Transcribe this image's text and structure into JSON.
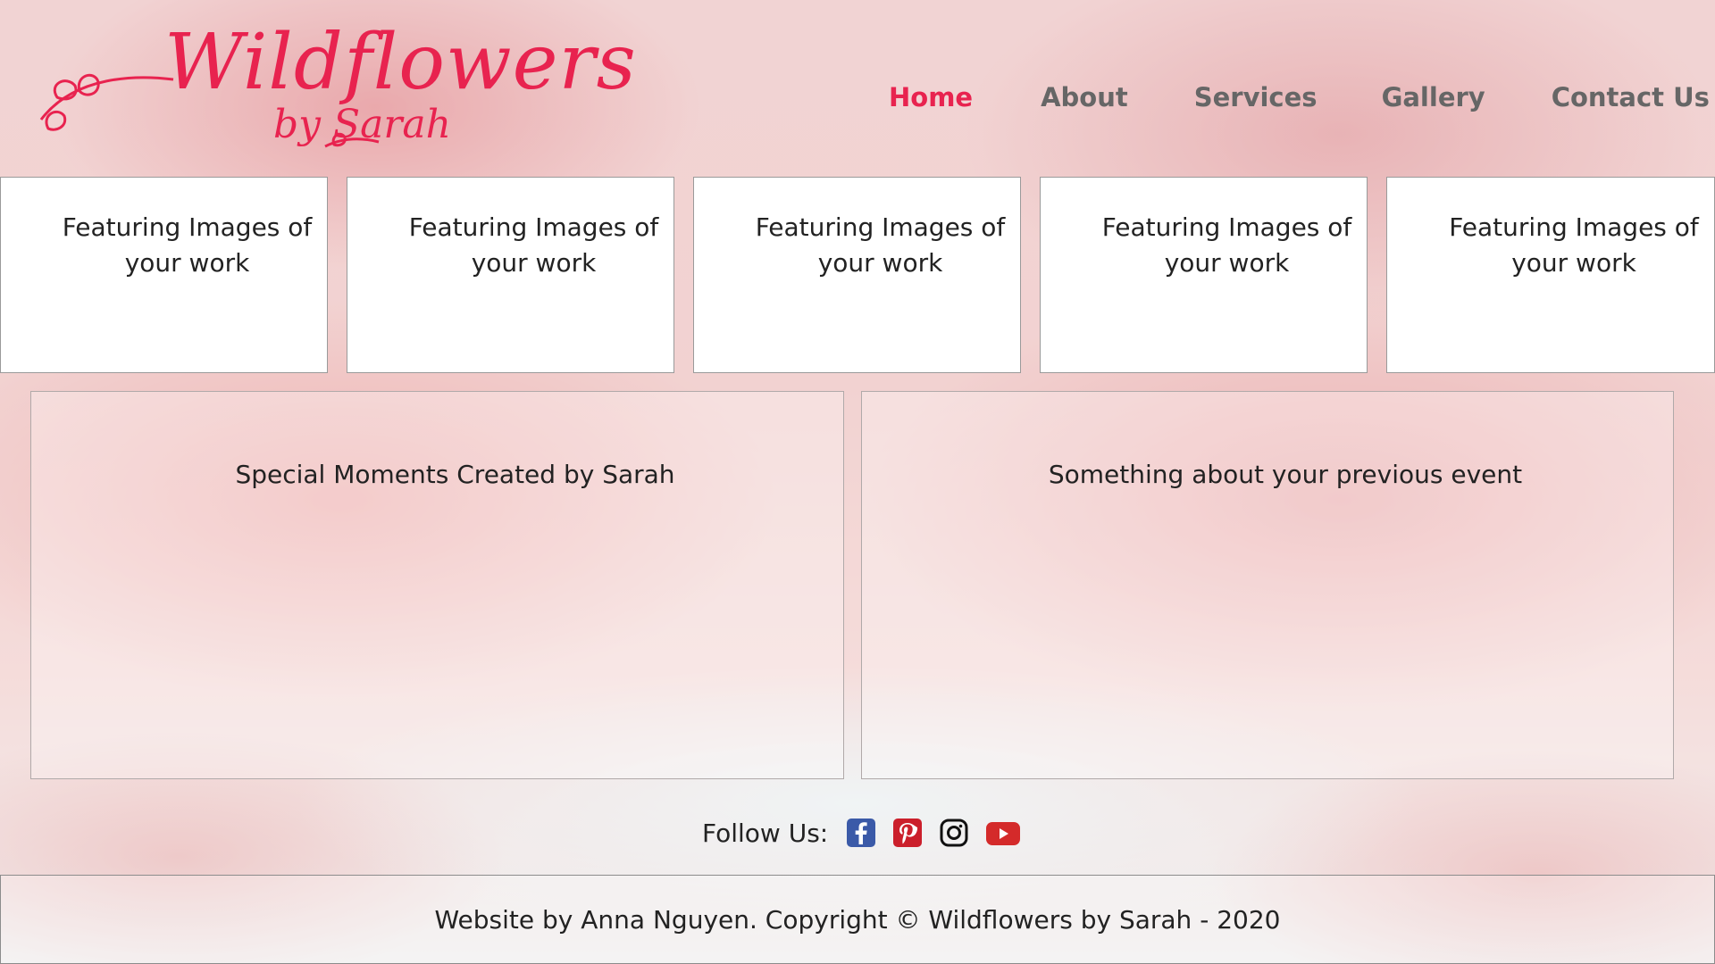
{
  "brand": {
    "name": "Wildflowers",
    "tagline": "by Sarah",
    "accent": "#e8234f"
  },
  "nav": {
    "items": [
      {
        "label": "Home",
        "active": true
      },
      {
        "label": "About",
        "active": false
      },
      {
        "label": "Services",
        "active": false
      },
      {
        "label": "Gallery",
        "active": false
      },
      {
        "label": "Contact Us",
        "active": false
      }
    ]
  },
  "features": [
    {
      "line1": "Featuring Images of",
      "line2": "your work"
    },
    {
      "line1": "Featuring Images of",
      "line2": "your work"
    },
    {
      "line1": "Featuring Images of",
      "line2": "your work"
    },
    {
      "line1": "Featuring Images of",
      "line2": "your work"
    },
    {
      "line1": "Featuring Images of",
      "line2": "your work"
    }
  ],
  "panels": [
    {
      "text": "Special Moments Created by Sarah"
    },
    {
      "text": "Something about your previous event"
    }
  ],
  "follow": {
    "label": "Follow Us:",
    "icons": [
      "facebook-icon",
      "pinterest-icon",
      "instagram-icon",
      "youtube-icon"
    ]
  },
  "footer": {
    "text": "Website by Anna Nguyen. Copyright © Wildflowers by Sarah - 2020"
  }
}
